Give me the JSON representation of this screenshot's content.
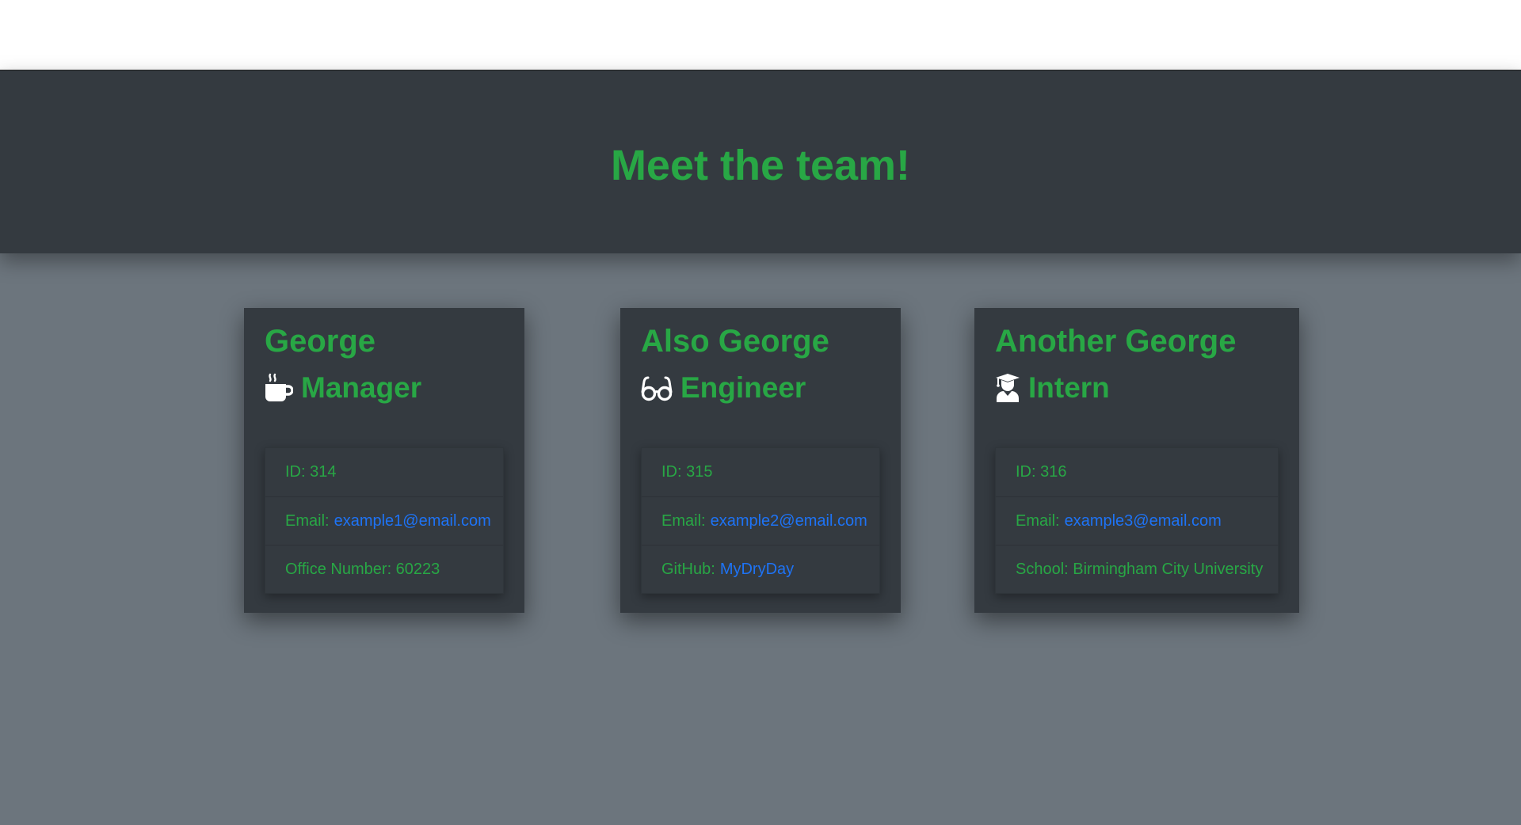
{
  "header": {
    "title": "Meet the team!"
  },
  "team": [
    {
      "name": "George",
      "role": "Manager",
      "role_icon": "coffee-icon",
      "id_text": "ID: 314",
      "email_label": "Email:",
      "email": "example1@email.com",
      "extra_text": "Office Number: 60223"
    },
    {
      "name": "Also George",
      "role": "Engineer",
      "role_icon": "glasses-icon",
      "id_text": "ID: 315",
      "email_label": "Email:",
      "email": "example2@email.com",
      "extra_label": "GitHub:",
      "extra_link": "MyDryDay"
    },
    {
      "name": "Another George",
      "role": "Intern",
      "role_icon": "graduate-icon",
      "id_text": "ID: 316",
      "email_label": "Email:",
      "email": "example3@email.com",
      "extra_text": "School: Birmingham City University"
    }
  ],
  "colors": {
    "header_bg": "#343a40",
    "page_bg": "#6c757d",
    "accent_green": "#28a745",
    "link_blue": "#1e73f5"
  }
}
